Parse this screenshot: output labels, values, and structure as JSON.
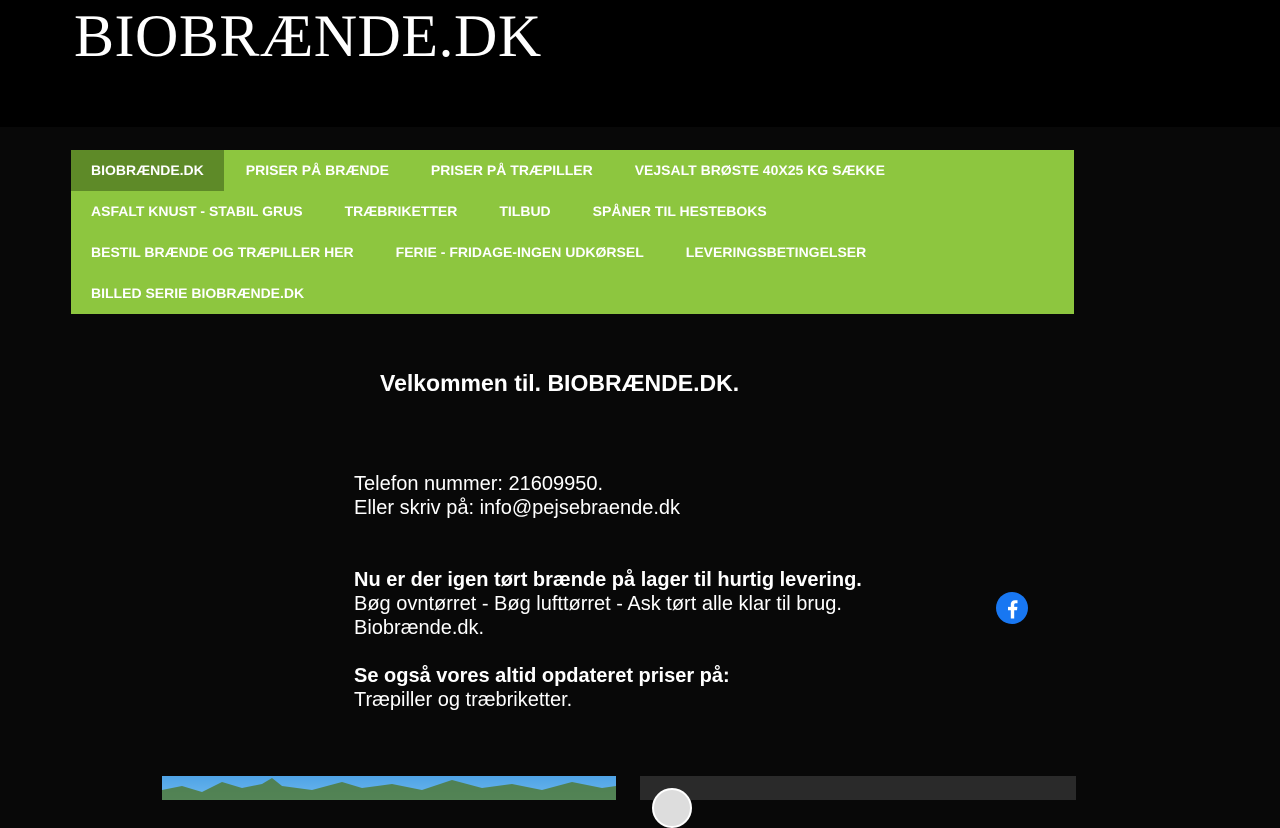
{
  "site": {
    "title": "BIOBRÆNDE.DK"
  },
  "nav": {
    "rows": [
      [
        "BIOBRÆNDE.DK",
        "PRISER PÅ BRÆNDE",
        "PRISER PÅ TRÆPILLER",
        "VEJSALT BRØSTE 40X25 KG SÆKKE"
      ],
      [
        "ASFALT KNUST - STABIL GRUS",
        "TRÆBRIKETTER",
        "TILBUD",
        "SPÅNER TIL HESTEBOKS"
      ],
      [
        "BESTIL BRÆNDE OG TRÆPILLER HER",
        "FERIE - FRIDAGE-INGEN UDKØRSEL",
        "LEVERINGSBETINGELSER"
      ],
      [
        "BILLED SERIE BIOBRÆNDE.DK"
      ]
    ],
    "active": "BIOBRÆNDE.DK"
  },
  "main": {
    "welcome": "Velkommen til. BIOBRÆNDE.DK.",
    "phone_line": "Telefon nummer: 21609950.",
    "email_line": "Eller skriv på: info@pejsebraende.dk",
    "stock_headline": "Nu er der igen tørt brænde på lager til hurtig levering.",
    "stock_types": "Bøg ovntørret - Bøg lufttørret - Ask tørt alle klar til brug.",
    "stock_sign": "Biobrænde.dk.",
    "prices_headline": "Se også vores altid opdateret priser på:",
    "prices_items": "Træpiller og træbriketter."
  },
  "colors": {
    "nav_bg": "#8dc63f",
    "nav_active": "#5e8a28",
    "facebook": "#1877f2"
  },
  "icons": {
    "social": "facebook-icon"
  }
}
